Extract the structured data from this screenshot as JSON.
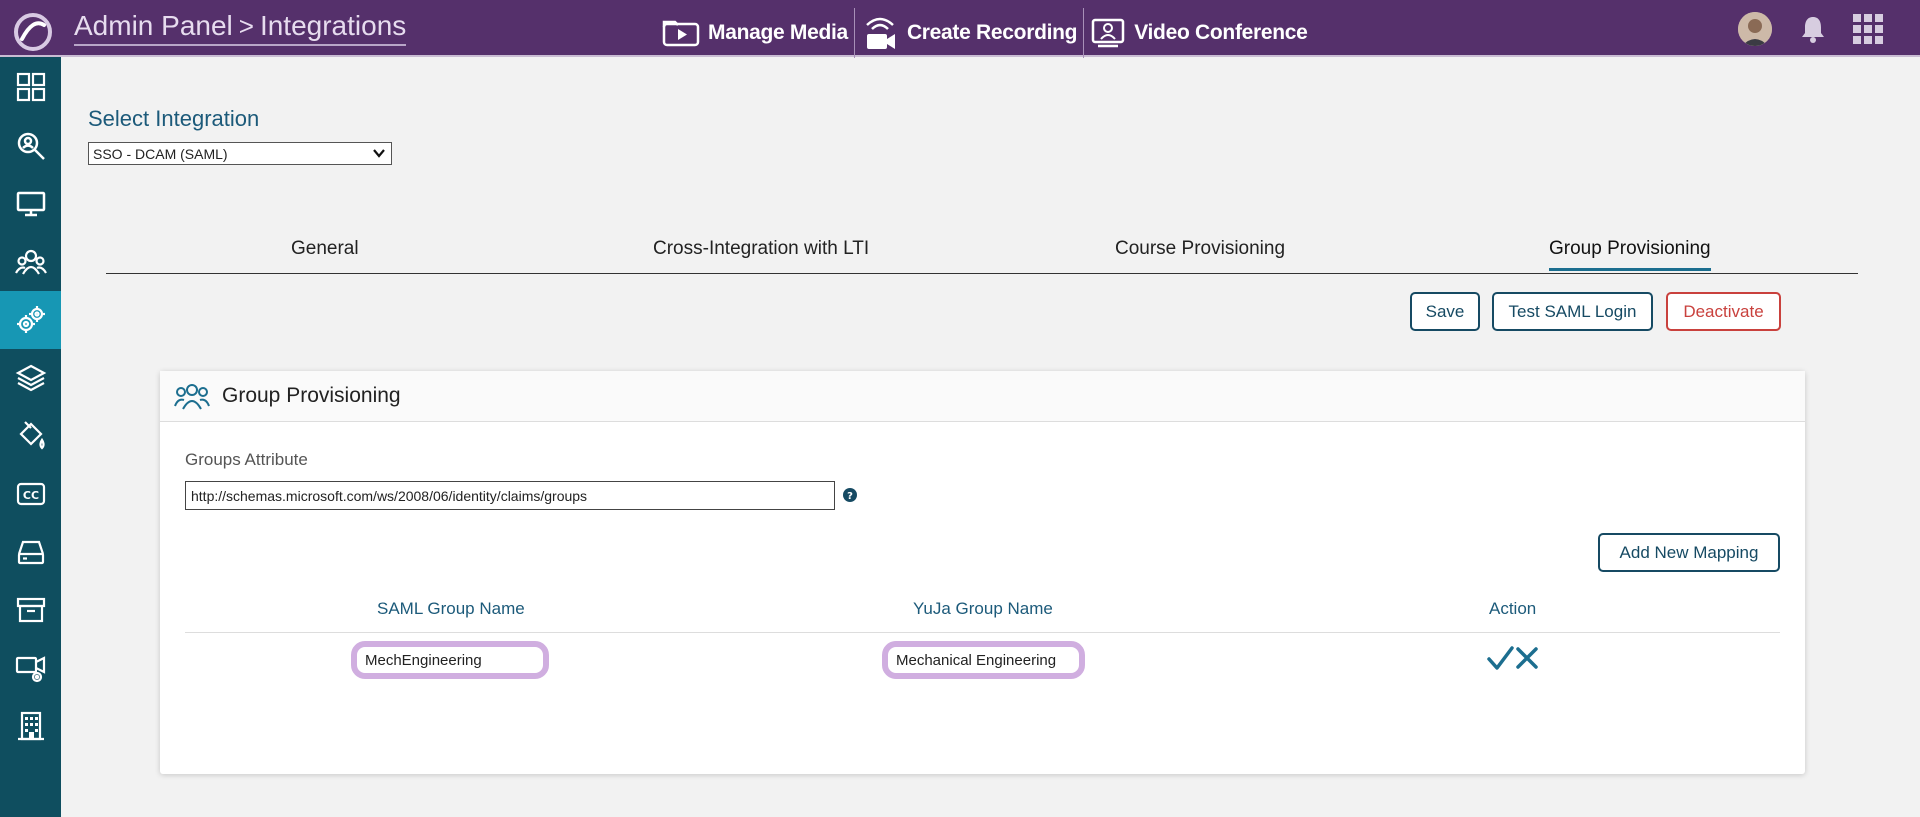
{
  "header": {
    "breadcrumb_root": "Admin Panel",
    "breadcrumb_separator": ">",
    "breadcrumb_current": "Integrations",
    "nav": [
      {
        "label": "Manage Media",
        "icon": "media-folder-icon"
      },
      {
        "label": "Create Recording",
        "icon": "recording-icon"
      },
      {
        "label": "Video Conference",
        "icon": "video-conference-icon"
      }
    ]
  },
  "sidebar": {
    "items": [
      {
        "icon": "dashboard-icon"
      },
      {
        "icon": "search-icon"
      },
      {
        "icon": "monitor-icon"
      },
      {
        "icon": "users-group-icon"
      },
      {
        "icon": "settings-gears-icon",
        "active": true
      },
      {
        "icon": "layers-icon"
      },
      {
        "icon": "paint-bucket-icon"
      },
      {
        "icon": "closed-captions-icon"
      },
      {
        "icon": "storage-drive-icon"
      },
      {
        "icon": "archive-icon"
      },
      {
        "icon": "video-settings-icon"
      },
      {
        "icon": "building-icon"
      }
    ]
  },
  "integration": {
    "label": "Select Integration",
    "selected": "SSO - DCAM (SAML)"
  },
  "tabs": [
    {
      "label": "General"
    },
    {
      "label": "Cross-Integration with LTI"
    },
    {
      "label": "Course Provisioning"
    },
    {
      "label": "Group Provisioning",
      "active": true
    }
  ],
  "actions": {
    "save": "Save",
    "test_login": "Test SAML Login",
    "deactivate": "Deactivate"
  },
  "panel": {
    "title": "Group Provisioning",
    "groups_attribute_label": "Groups Attribute",
    "groups_attribute_value": "http://schemas.microsoft.com/ws/2008/06/identity/claims/groups",
    "add_mapping": "Add New Mapping",
    "columns": {
      "saml": "SAML Group Name",
      "yuja": "YuJa Group Name",
      "action": "Action"
    },
    "rows": [
      {
        "saml": "MechEngineering",
        "yuja": "Mechanical Engineering"
      }
    ]
  },
  "colors": {
    "header_bg": "#55306b",
    "sidebar_bg": "#0f4e5f",
    "sidebar_active": "#1797b4",
    "primary": "#164a63",
    "danger": "#c9413d",
    "highlight": "#d0aee0"
  }
}
